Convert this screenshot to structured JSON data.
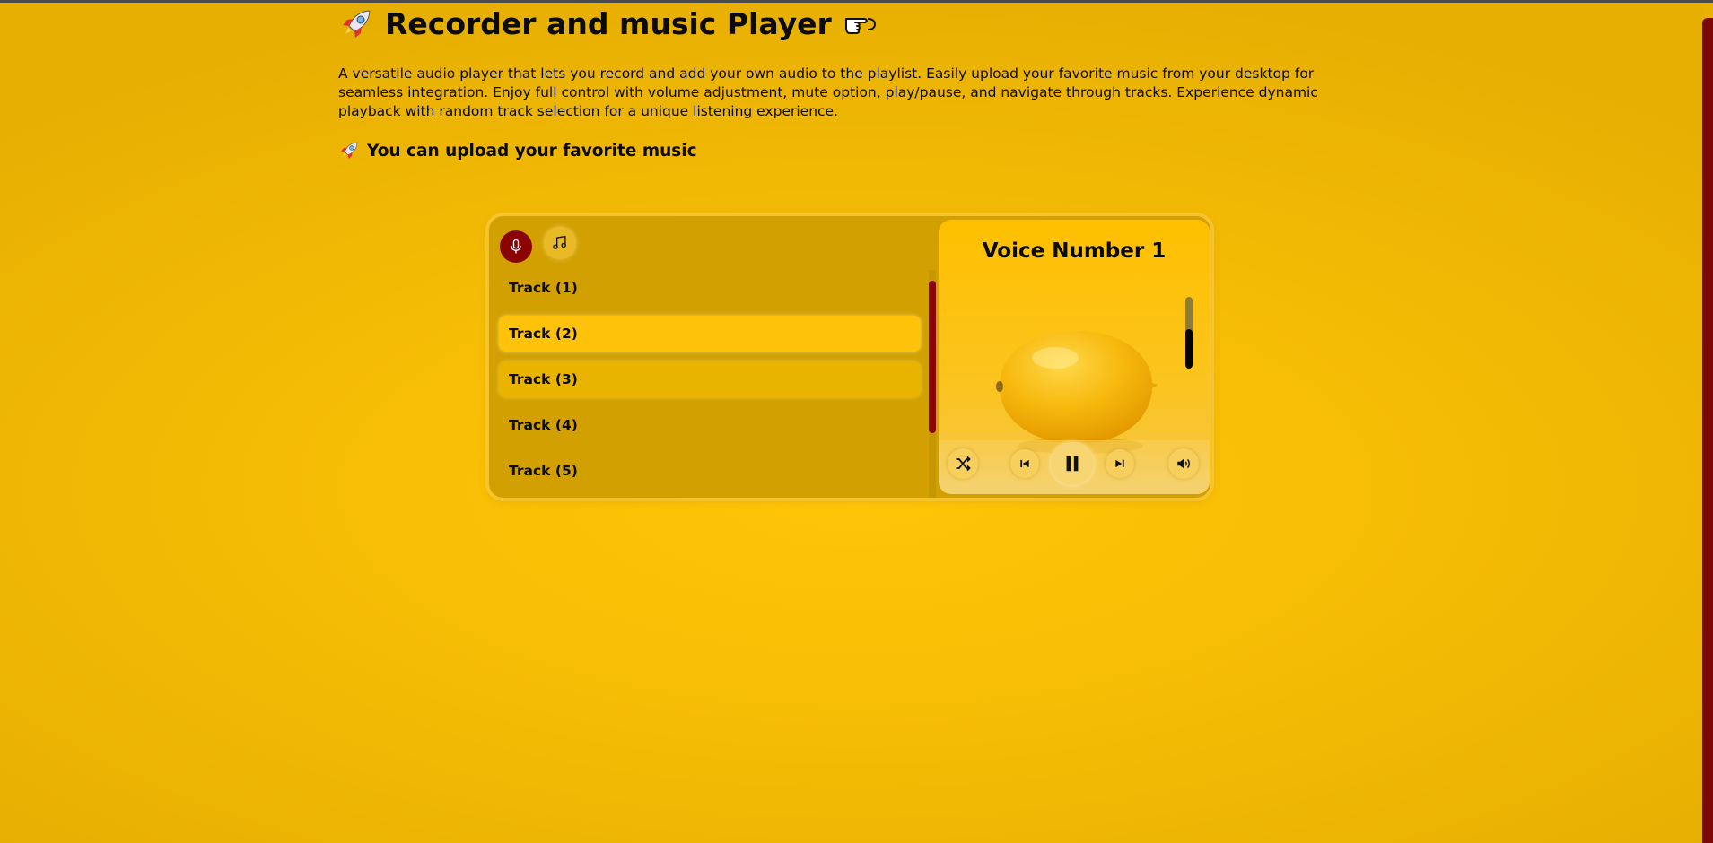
{
  "header": {
    "title": "Recorder and music Player",
    "title_icon_left": "rocket-icon",
    "title_icon_right": "pointing-hand-icon",
    "description": "A versatile audio player that lets you record and add your own audio to the playlist. Easily upload your favorite music from your desktop for seamless integration. Enjoy full control with volume adjustment, mute option, play/pause, and navigate through tracks. Experience dynamic playback with random track selection for a unique listening experience.",
    "subtitle": "You can upload your favorite music",
    "subtitle_icon": "rocket-icon"
  },
  "playlist": {
    "record_button_icon": "microphone-icon",
    "upload_button_icon": "music-note-icon",
    "tracks": [
      {
        "label": "Track (1)",
        "state": "normal"
      },
      {
        "label": "Track (2)",
        "state": "active"
      },
      {
        "label": "Track (3)",
        "state": "hover"
      },
      {
        "label": "Track (4)",
        "state": "normal"
      },
      {
        "label": "Track (5)",
        "state": "normal"
      }
    ]
  },
  "now_playing": {
    "title": "Voice Number 1",
    "cover_image": "lemon",
    "volume_level": 0.55,
    "controls": {
      "shuffle_icon": "shuffle-icon",
      "previous_icon": "skip-previous-icon",
      "play_state": "playing",
      "play_pause_icon": "pause-icon",
      "next_icon": "skip-next-icon",
      "volume_icon": "volume-icon"
    }
  },
  "colors": {
    "background": "#f6bd05",
    "accent_dark_red": "#8a0303",
    "active_track": "#ffc20a",
    "panel": "#d2a000"
  }
}
